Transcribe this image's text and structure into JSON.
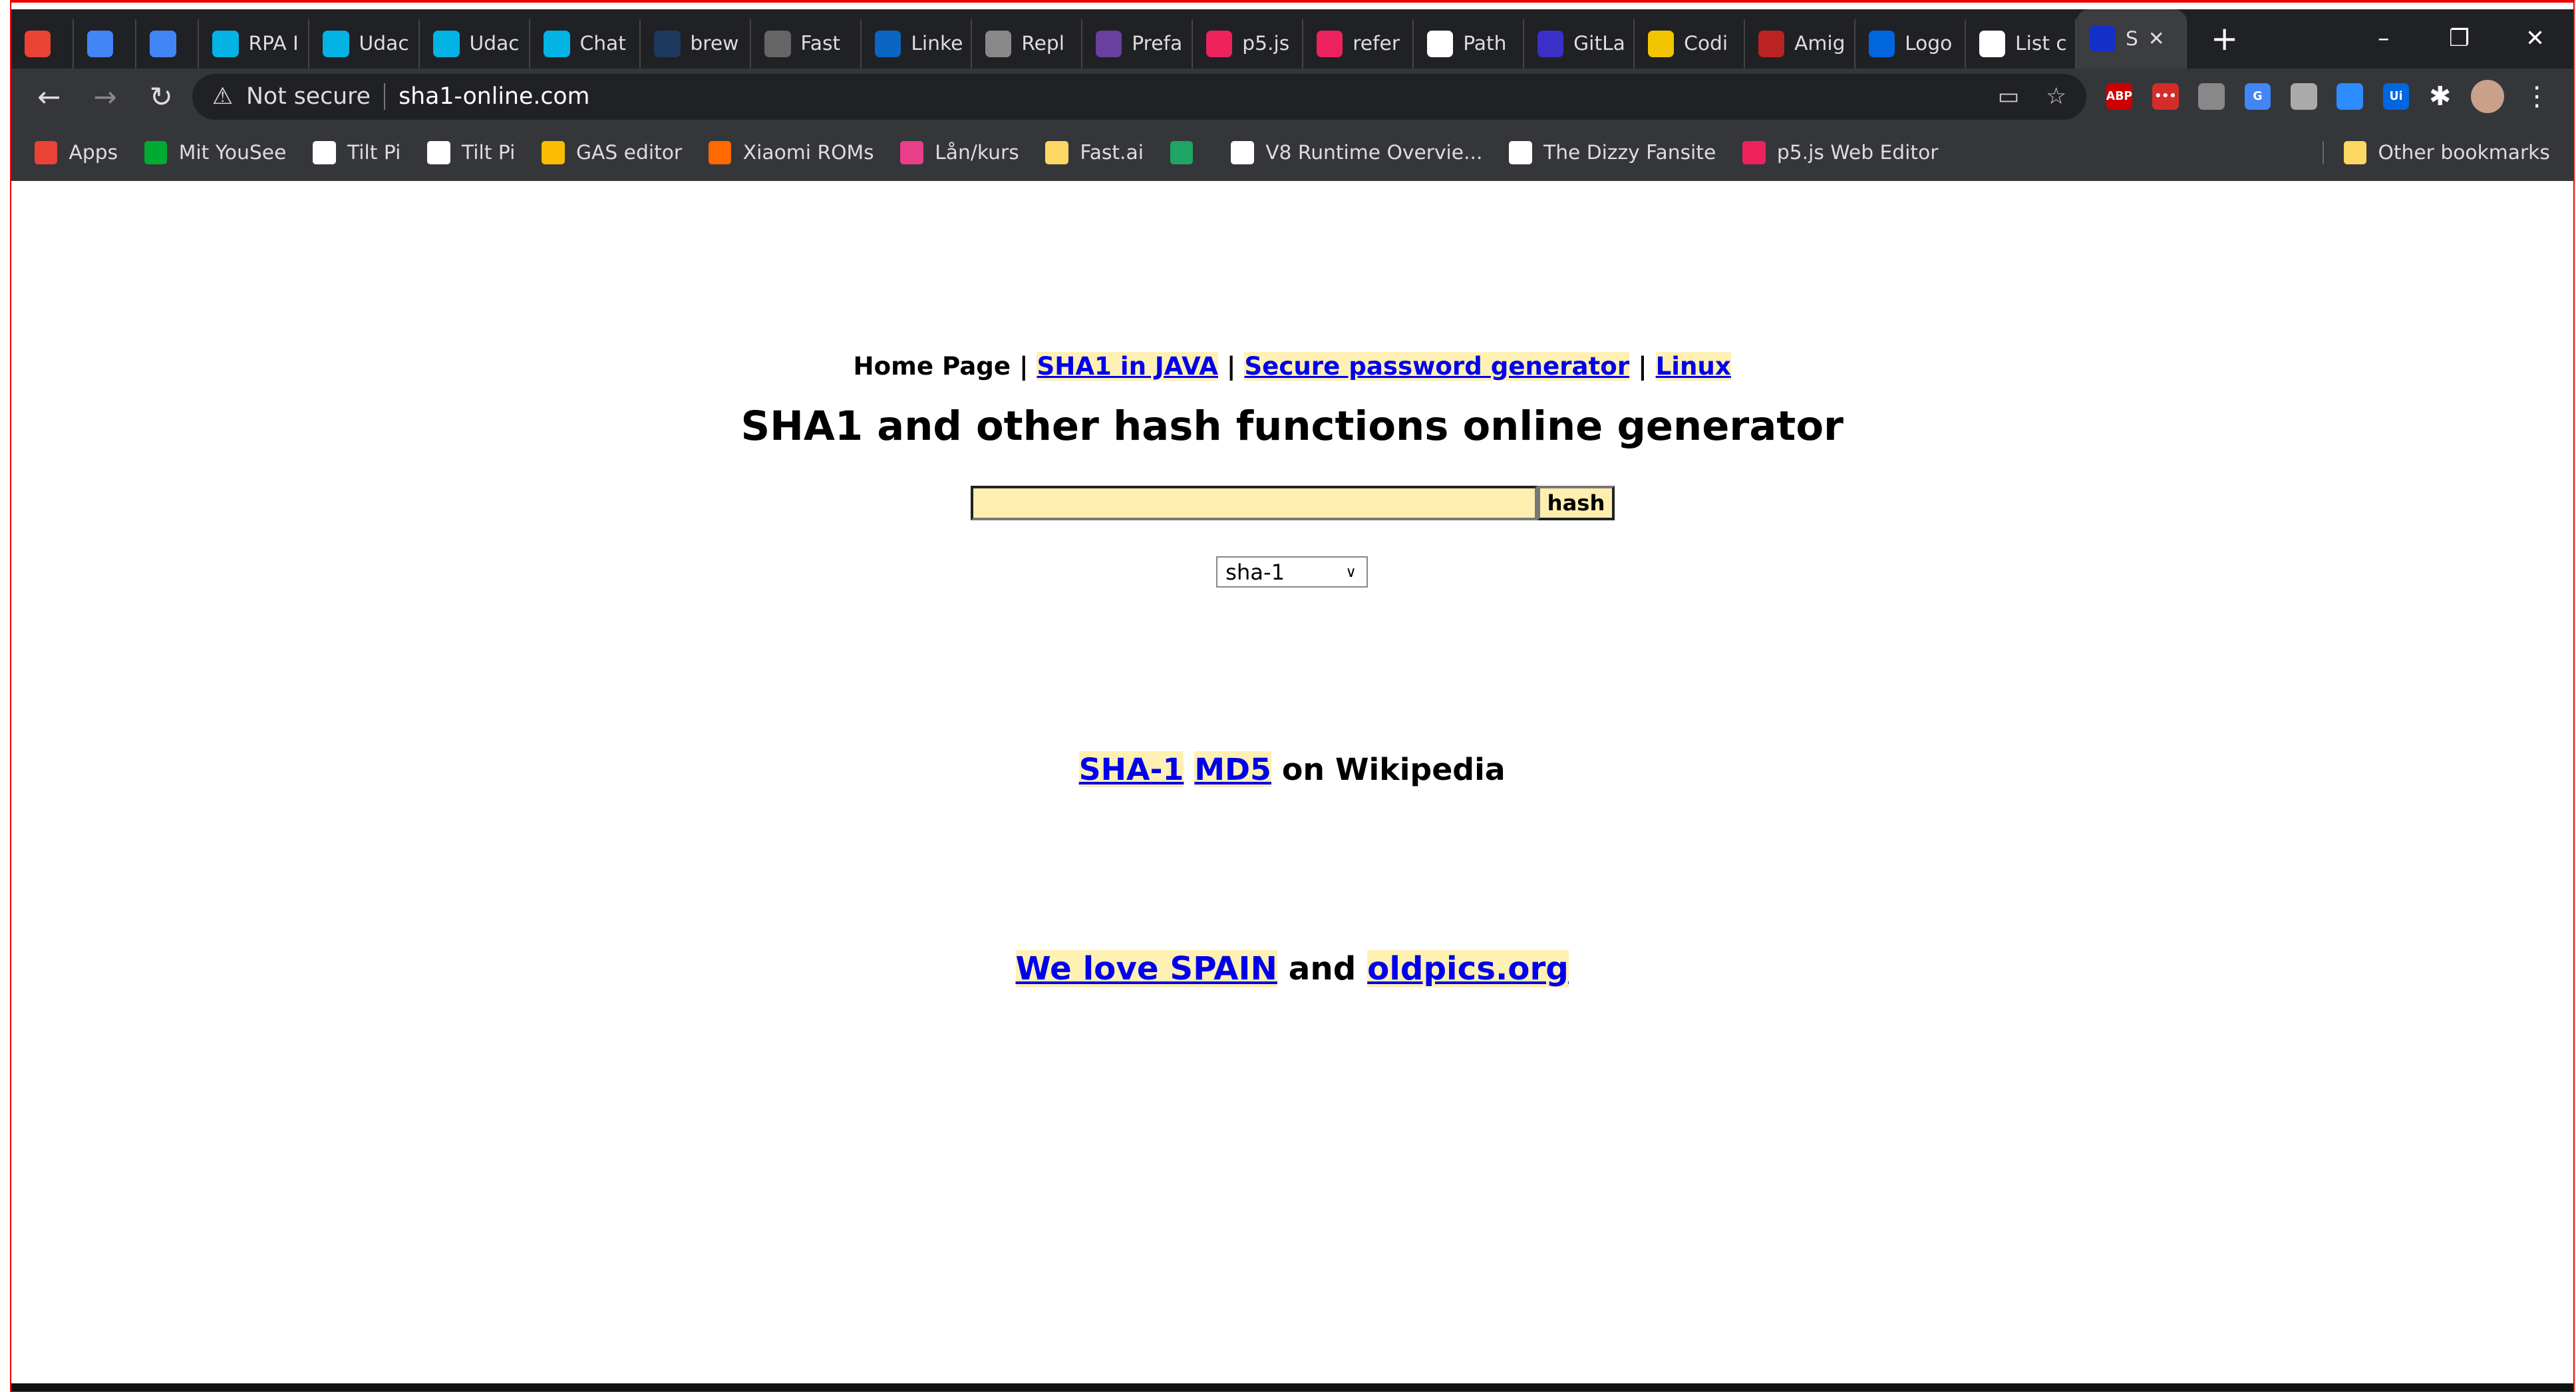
{
  "browser": {
    "tabs": [
      {
        "label": "",
        "icon": "gmail-icon",
        "color": "#ea4335"
      },
      {
        "label": "",
        "icon": "calendar-icon",
        "color": "#4285f4"
      },
      {
        "label": "",
        "icon": "translate-icon",
        "color": "#4285f4"
      },
      {
        "label": "RPA I",
        "icon": "udacity-icon",
        "color": "#02b3e4"
      },
      {
        "label": "Udac",
        "icon": "udacity-icon",
        "color": "#02b3e4"
      },
      {
        "label": "Udac",
        "icon": "udacity-icon",
        "color": "#02b3e4"
      },
      {
        "label": "Chat",
        "icon": "udacity-icon",
        "color": "#02b3e4"
      },
      {
        "label": "brew",
        "icon": "ss-icon",
        "color": "#1d3a5c"
      },
      {
        "label": "Fast",
        "icon": "globe-icon",
        "color": "#666"
      },
      {
        "label": "Linke",
        "icon": "linkedin-icon",
        "color": "#0a66c2"
      },
      {
        "label": "Repl",
        "icon": "replit-icon",
        "color": "#888"
      },
      {
        "label": "Prefa",
        "icon": "prefab-icon",
        "color": "#6a3fa0"
      },
      {
        "label": "p5.js",
        "icon": "p5-icon",
        "color": "#ed225d"
      },
      {
        "label": "refer",
        "icon": "p5-icon",
        "color": "#ed225d"
      },
      {
        "label": "Path",
        "icon": "devtools-icon",
        "color": "#fff"
      },
      {
        "label": "GitLa",
        "icon": "gitlab-icon",
        "color": "#3b2fc9"
      },
      {
        "label": "Codi",
        "icon": "codingame-icon",
        "color": "#f2c500"
      },
      {
        "label": "Amig",
        "icon": "amiga-icon",
        "color": "#b22"
      },
      {
        "label": "Logo",
        "icon": "uipath-icon",
        "color": "#0067df"
      },
      {
        "label": "List c",
        "icon": "wikipedia-icon",
        "color": "#fff"
      },
      {
        "label": "S",
        "icon": "sha1-site-icon",
        "color": "#1530c8",
        "active": true
      }
    ],
    "address": {
      "security": "Not secure",
      "url": "sha1-online.com"
    },
    "extensions": [
      {
        "name": "abp-icon",
        "label": "ABP",
        "color": "#c00"
      },
      {
        "name": "lastpass-icon",
        "label": "•••",
        "color": "#d32d27"
      },
      {
        "name": "openai-icon",
        "label": "",
        "color": "#888"
      },
      {
        "name": "translate-icon",
        "label": "G",
        "color": "#4285f4"
      },
      {
        "name": "extension-k-icon",
        "label": "",
        "color": "#aaa"
      },
      {
        "name": "zoom-icon",
        "label": "",
        "color": "#2d8cff"
      },
      {
        "name": "uipath-icon",
        "label": "Ui",
        "color": "#0067df"
      }
    ],
    "bookmarks": [
      {
        "label": "Apps",
        "color": "#ea4335"
      },
      {
        "label": "Mit YouSee",
        "color": "#0a3"
      },
      {
        "label": "Tilt Pi",
        "color": "#fff"
      },
      {
        "label": "Tilt Pi",
        "color": "#fff"
      },
      {
        "label": "GAS editor",
        "color": "#fbbc04"
      },
      {
        "label": "Xiaomi ROMs",
        "color": "#ff6900"
      },
      {
        "label": "Lån/kurs",
        "color": "#e83e8c"
      },
      {
        "label": "Fast.ai",
        "color": "#fdd663"
      },
      {
        "label": "",
        "color": "#1fa463"
      },
      {
        "label": "V8 Runtime Overvie...",
        "color": "#fff"
      },
      {
        "label": "The Dizzy Fansite",
        "color": "#fff"
      },
      {
        "label": "p5.js Web Editor",
        "color": "#ed225d"
      }
    ],
    "other_bookmarks": "Other bookmarks"
  },
  "page": {
    "nav": {
      "home": "Home Page",
      "sep": "|",
      "links": [
        "SHA1 in JAVA",
        "Secure password generator",
        "Linux"
      ]
    },
    "title": "SHA1 and other hash functions online generator",
    "input_value": "",
    "hash_button": "hash",
    "algorithm": "sha-1",
    "wiki": {
      "links": [
        "SHA-1",
        "MD5"
      ],
      "suffix": "on Wikipedia"
    },
    "footer": {
      "link1": "We love SPAIN",
      "and": "and",
      "link2": "oldpics.org"
    }
  }
}
